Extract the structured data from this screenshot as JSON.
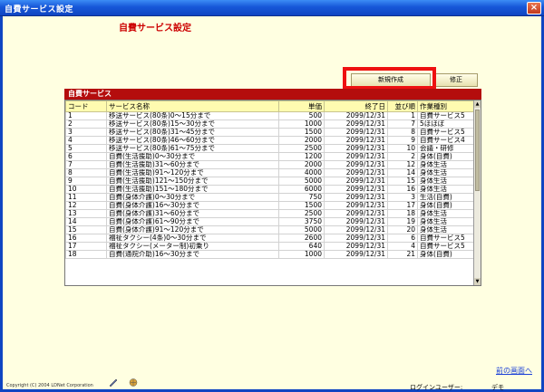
{
  "window": {
    "title": "自費サービス設定",
    "close_icon": "close-icon"
  },
  "page_title": "自費サービス設定",
  "toolbar": {
    "new_label": "新規作成",
    "edit_label": "修正"
  },
  "panel": {
    "title": "自費サービス",
    "columns": [
      "コード",
      "サービス名称",
      "単価",
      "終了日",
      "並び順",
      "作業種別"
    ],
    "rows": [
      [
        "1",
        "移送サービス(80条)0～15分まで",
        "500",
        "2099/12/31",
        "1",
        "自費サービス5"
      ],
      [
        "2",
        "移送サービス(80条)15～30分まで",
        "1000",
        "2099/12/31",
        "7",
        "5ほほぼ"
      ],
      [
        "3",
        "移送サービス(80条)31～45分まで",
        "1500",
        "2099/12/31",
        "8",
        "自費サービス5"
      ],
      [
        "4",
        "移送サービス(80条)46～60分まで",
        "2000",
        "2099/12/31",
        "9",
        "自費サービス4"
      ],
      [
        "5",
        "移送サービス(80条)61～75分まで",
        "2500",
        "2099/12/31",
        "10",
        "会議・研修"
      ],
      [
        "6",
        "自費(生活援助)0～30分まで",
        "1200",
        "2099/12/31",
        "2",
        "身体(自費)"
      ],
      [
        "7",
        "自費(生活援助)31～60分まで",
        "2000",
        "2099/12/31",
        "12",
        "身体生活"
      ],
      [
        "8",
        "自費(生活援助)91～120分まで",
        "4000",
        "2099/12/31",
        "14",
        "身体生活"
      ],
      [
        "9",
        "自費(生活援助)121～150分まで",
        "5000",
        "2099/12/31",
        "15",
        "身体生活"
      ],
      [
        "10",
        "自費(生活援助)151～180分まで",
        "6000",
        "2099/12/31",
        "16",
        "身体生活"
      ],
      [
        "11",
        "自費(身体介護)0～30分まで",
        "750",
        "2099/12/31",
        "3",
        "生活(自費)"
      ],
      [
        "12",
        "自費(身体介護)16～30分まで",
        "1500",
        "2099/12/31",
        "17",
        "身体(自費)"
      ],
      [
        "13",
        "自費(身体介護)31～60分まで",
        "2500",
        "2099/12/31",
        "18",
        "身体生活"
      ],
      [
        "14",
        "自費(身体介護)61～90分まで",
        "3750",
        "2099/12/31",
        "19",
        "身体生活"
      ],
      [
        "15",
        "自費(身体介護)91～120分まで",
        "5000",
        "2099/12/31",
        "20",
        "身体生活"
      ],
      [
        "16",
        "福祉タクシー(4条)0～30分まで",
        "2600",
        "2099/12/31",
        "6",
        "自費サービス5"
      ],
      [
        "17",
        "福祉タクシー(メーター制)初乗り",
        "640",
        "2099/12/31",
        "4",
        "自費サービス5"
      ],
      [
        "18",
        "自費(通院介助)16～30分まで",
        "1000",
        "2099/12/31",
        "21",
        "身体(自費)"
      ]
    ]
  },
  "footer": {
    "back_link": "前の画面へ",
    "copyright": "Copyright (C) 2004 LDNet Corporation",
    "login_label": "ログインユーザー:",
    "login_user": "デモ"
  },
  "colors": {
    "accent": "#cc0000",
    "panel_header": "#b40d0d",
    "highlight": "#ee1111",
    "titlebar": "#1757d8"
  }
}
